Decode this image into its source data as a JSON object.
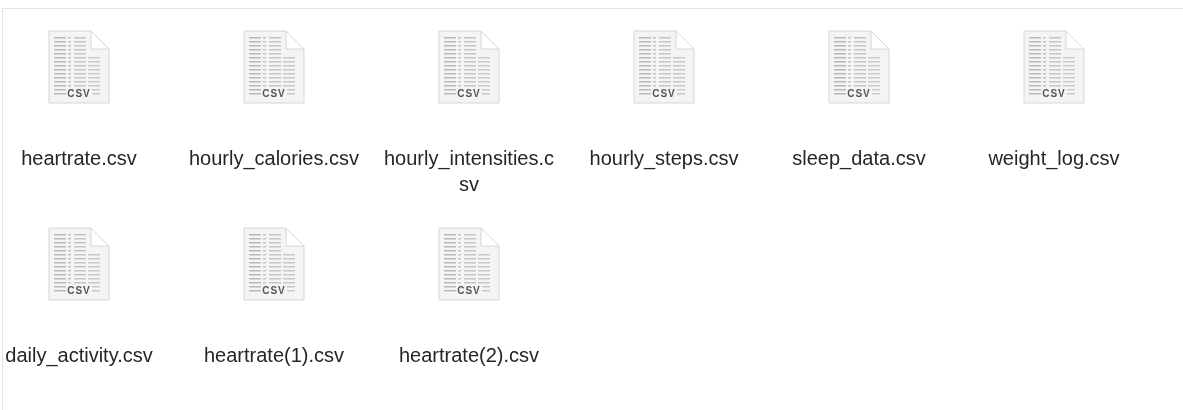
{
  "files": [
    {
      "name": "heartrate.csv",
      "badge": "CSV"
    },
    {
      "name": "hourly_calories.csv",
      "badge": "CSV"
    },
    {
      "name": "hourly_intensities.csv",
      "badge": "CSV"
    },
    {
      "name": "hourly_steps.csv",
      "badge": "CSV"
    },
    {
      "name": "sleep_data.csv",
      "badge": "CSV"
    },
    {
      "name": "weight_log.csv",
      "badge": "CSV"
    },
    {
      "name": "daily_activity.csv",
      "badge": "CSV"
    },
    {
      "name": "heartrate(1).csv",
      "badge": "CSV"
    },
    {
      "name": "heartrate(2).csv",
      "badge": "CSV"
    }
  ]
}
